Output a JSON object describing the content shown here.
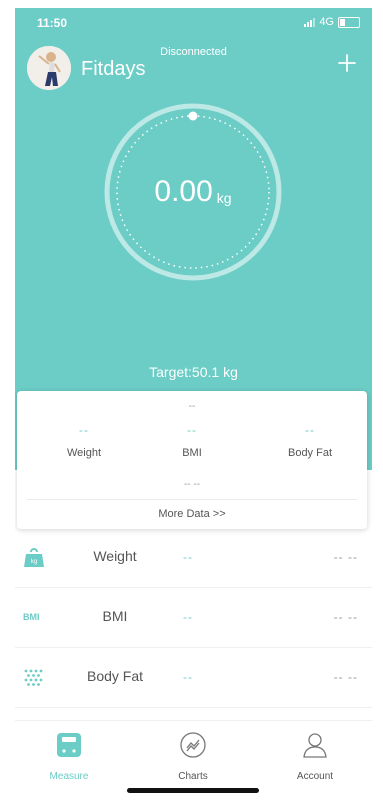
{
  "status_bar": {
    "time": "11:50",
    "network": "4G"
  },
  "header": {
    "brand": "Fitdays",
    "connection_status": "Disconnected",
    "add_icon": "plus-icon",
    "avatar_icon": "user-avatar"
  },
  "gauge": {
    "value": "0.00",
    "unit": "kg"
  },
  "target": "Target:50.1 kg",
  "summary_card": {
    "top_placeholder": "--",
    "metrics": [
      {
        "value": "--",
        "label": "Weight"
      },
      {
        "value": "--",
        "label": "BMI"
      },
      {
        "value": "--",
        "label": "Body Fat"
      }
    ],
    "bottom_placeholder": "-- --",
    "more_link": "More Data >>"
  },
  "metric_rows": [
    {
      "icon": "weight-kg-icon",
      "label": "Weight",
      "value": "--",
      "right": "-- --"
    },
    {
      "icon": "bmi-icon",
      "label": "BMI",
      "value": "--",
      "right": "-- --",
      "icon_text": "BMI"
    },
    {
      "icon": "body-fat-icon",
      "label": "Body Fat",
      "value": "--",
      "right": "-- --"
    }
  ],
  "tabs": [
    {
      "label": "Measure",
      "icon": "scale-icon",
      "active": true
    },
    {
      "label": "Charts",
      "icon": "chart-icon",
      "active": false
    },
    {
      "label": "Account",
      "icon": "person-icon",
      "active": false
    }
  ],
  "colors": {
    "primary": "#6cccc6",
    "text": "#555555"
  }
}
